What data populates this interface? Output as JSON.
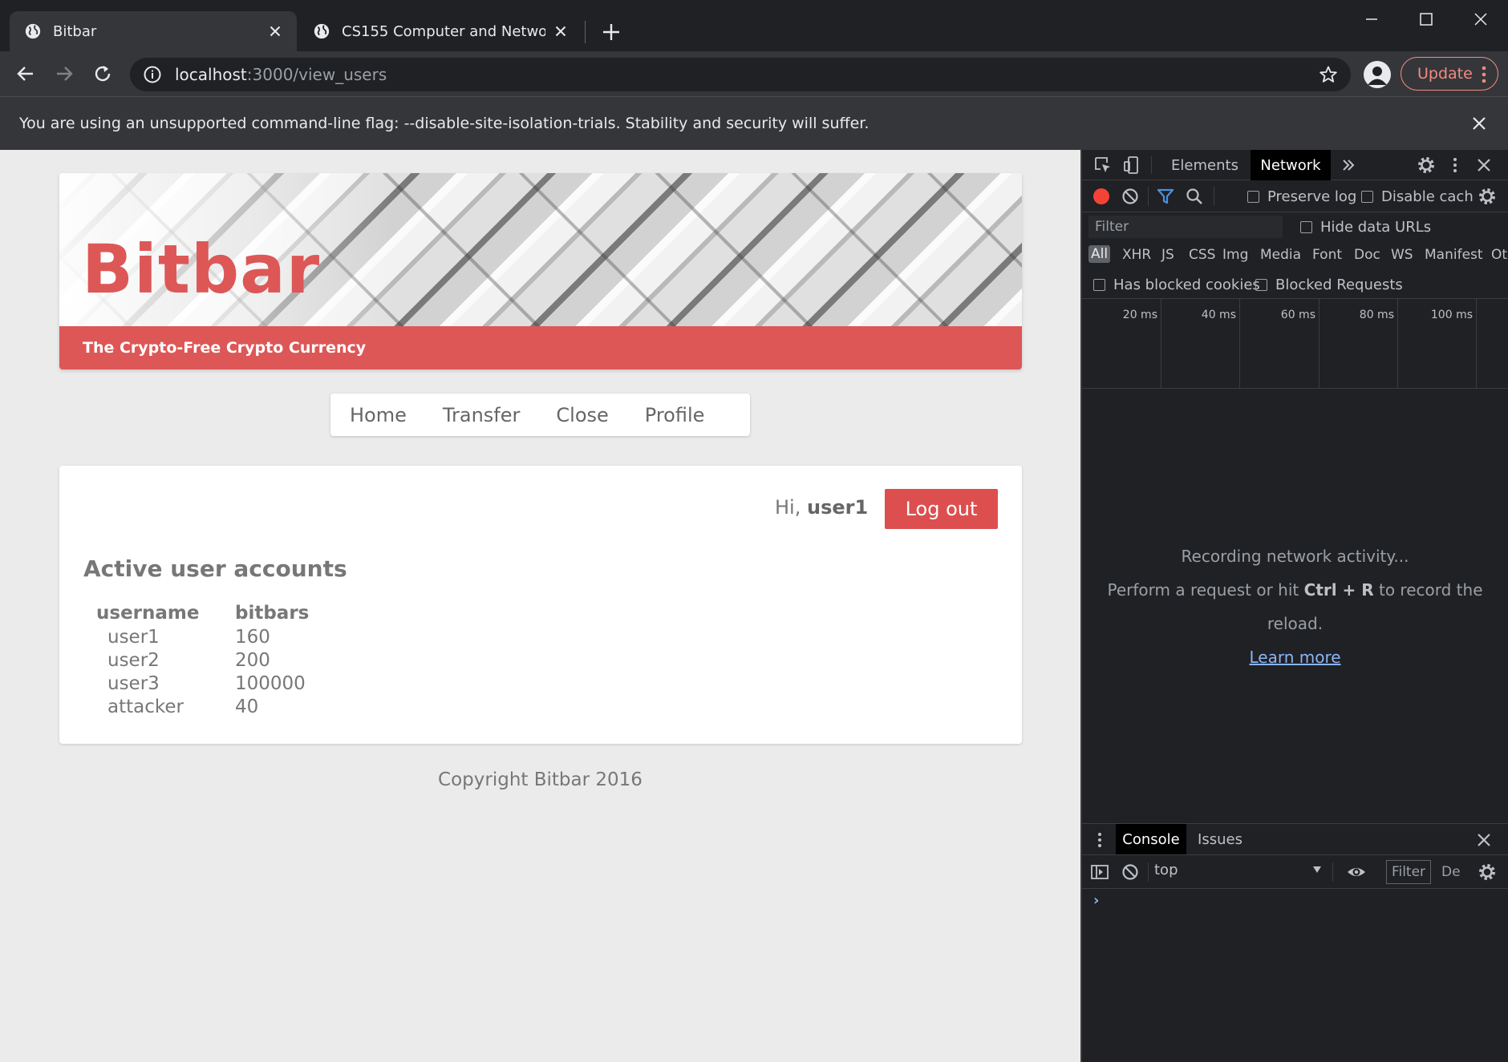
{
  "browser": {
    "tabs": [
      {
        "title": "Bitbar",
        "active": true
      },
      {
        "title": "CS155 Computer and Network Se",
        "active": false
      }
    ],
    "url_host": "localhost",
    "url_path": ":3000/view_users",
    "update_label": "Update",
    "infobar_text": "You are using an unsupported command-line flag: --disable-site-isolation-trials. Stability and security will suffer."
  },
  "site": {
    "brand": "Bitbar",
    "tagline": "The Crypto-Free Crypto Currency",
    "nav": [
      "Home",
      "Transfer",
      "Close",
      "Profile"
    ],
    "greeting_prefix": "Hi,",
    "username": "user1",
    "logout_label": "Log out",
    "section_title": "Active user accounts",
    "table": {
      "headers": [
        "username",
        "bitbars"
      ],
      "rows": [
        [
          "user1",
          "160"
        ],
        [
          "user2",
          "200"
        ],
        [
          "user3",
          "100000"
        ],
        [
          "attacker",
          "40"
        ]
      ]
    },
    "footer": "Copyright Bitbar 2016",
    "colors": {
      "accent": "#dd5757",
      "button": "#dd4f4f"
    }
  },
  "devtools": {
    "tabs": [
      "Elements",
      "Network"
    ],
    "active_tab": "Network",
    "preserve_log": "Preserve log",
    "disable_cache": "Disable cach",
    "filter_placeholder": "Filter",
    "hide_data_urls": "Hide data URLs",
    "types": [
      "All",
      "XHR",
      "JS",
      "CSS",
      "Img",
      "Media",
      "Font",
      "Doc",
      "WS",
      "Manifest",
      "Ot"
    ],
    "has_blocked_cookies": "Has blocked cookies",
    "blocked_requests": "Blocked Requests",
    "timeline_ticks": [
      "20 ms",
      "40 ms",
      "60 ms",
      "80 ms",
      "100 ms"
    ],
    "empty_line1": "Recording network activity...",
    "empty_line2_pre": "Perform a request or hit",
    "empty_shortcut": "Ctrl + R",
    "empty_line2_post": "to record the",
    "empty_line3": "reload.",
    "learn_more": "Learn more",
    "drawer_tabs": [
      "Console",
      "Issues"
    ],
    "context": "top",
    "console_filter": "Filter",
    "console_levels": "De",
    "prompt": "›"
  }
}
